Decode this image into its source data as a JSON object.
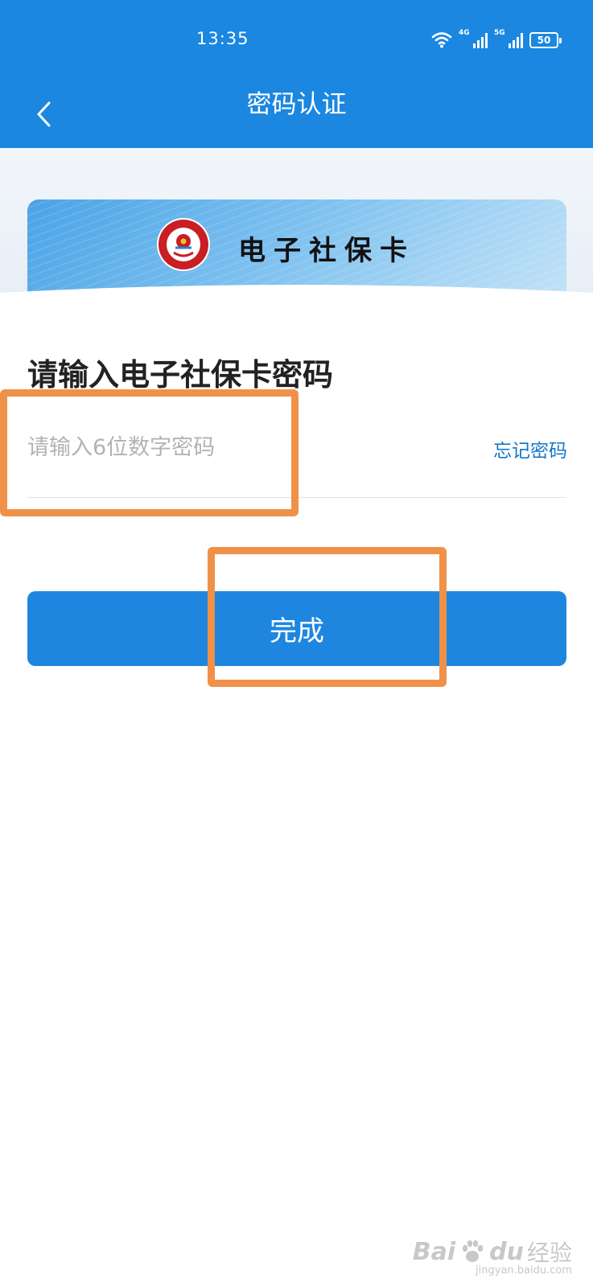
{
  "status_bar": {
    "time": "13:35",
    "signal_1": "4G",
    "signal_2": "5G",
    "battery": "50"
  },
  "nav": {
    "title": "密码认证"
  },
  "card": {
    "title": "电子社保卡"
  },
  "form": {
    "prompt": "请输入电子社保卡密码",
    "password_placeholder": "请输入6位数字密码",
    "password_value": "",
    "forgot_link": "忘记密码",
    "submit_label": "完成"
  },
  "watermark": {
    "brand": "Bai",
    "brand_accent": "du",
    "suffix": "经验",
    "url": "jingyan.baidu.com"
  },
  "colors": {
    "primary": "#1b87e0",
    "link": "#1577c8",
    "highlight": "#f0914a"
  }
}
